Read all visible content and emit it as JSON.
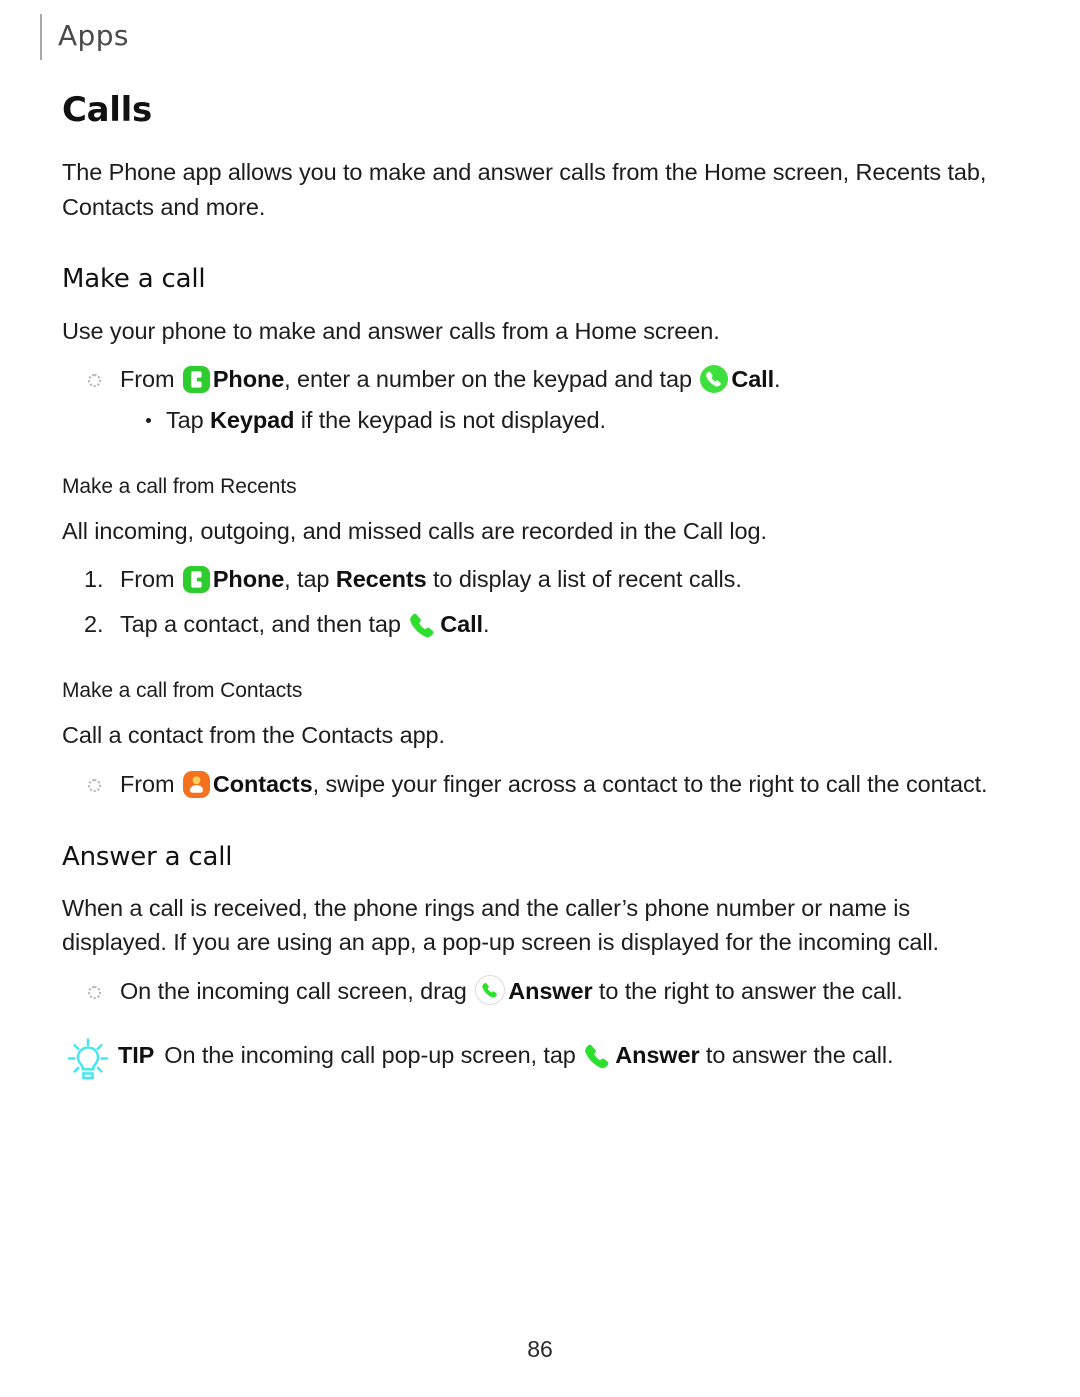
{
  "header": {
    "running_label": "Apps"
  },
  "chapter": {
    "title": "Calls",
    "intro": "The Phone app allows you to make and answer calls from the Home screen, Recents tab, Contacts and more."
  },
  "make_a_call": {
    "heading": "Make a call",
    "intro": "Use your phone to make and answer calls from a Home screen.",
    "step": {
      "before_phone": "From ",
      "phone_label": "Phone",
      "between": ", enter a number on the keypad and tap ",
      "call_label": "Call",
      "after": "."
    },
    "subbullet": {
      "before": "Tap ",
      "keypad_label": "Keypad",
      "after": " if the keypad is not displayed."
    }
  },
  "from_recents": {
    "subheading": "Make a call from Recents",
    "intro": "All incoming, outgoing, and missed calls are recorded in the Call log.",
    "steps": [
      {
        "number": "1.",
        "before_phone": "From ",
        "phone_label": "Phone",
        "between": ", tap ",
        "recents_label": "Recents",
        "after": " to display a list of recent calls."
      },
      {
        "number": "2.",
        "before_icon": "Tap a contact, and then tap ",
        "call_label": "Call",
        "after": "."
      }
    ]
  },
  "from_contacts": {
    "subheading": "Make a call from Contacts",
    "intro": "Call a contact from the Contacts app.",
    "step": {
      "before_icon": "From ",
      "contacts_label": "Contacts",
      "after": ", swipe your finger across a contact to the right to call the contact."
    }
  },
  "answer_a_call": {
    "heading": "Answer a call",
    "intro": "When a call is received, the phone rings and the caller’s phone number or name is displayed. If you are using an app, a pop-up screen is displayed for the incoming call.",
    "step": {
      "before_icon": "On the incoming call screen, drag ",
      "answer_label": "Answer",
      "after": " to the right to answer the call."
    }
  },
  "tip": {
    "label": "TIP",
    "before_icon": "On the incoming call pop-up screen, tap ",
    "answer_label": "Answer",
    "after": " to answer the call."
  },
  "footer": {
    "page_number": "86"
  },
  "icons": {
    "phone_app": "phone-app-icon",
    "contacts_app": "contacts-app-icon",
    "call_circle": "call-icon",
    "call_handset": "call-handset-icon",
    "answer_ring": "answer-icon",
    "tip_bulb": "lightbulb-icon",
    "bullet_dotted": "dotted-bullet-icon"
  },
  "colors": {
    "phone_green": "#2ecc2e",
    "call_green": "#3ee03e",
    "handset_green": "#2ee02e",
    "contacts_orange": "#f4711e",
    "contacts_head": "#ffcf5c",
    "tip_cyan": "#3de8f0",
    "rule_gray": "#a8a8a8"
  }
}
